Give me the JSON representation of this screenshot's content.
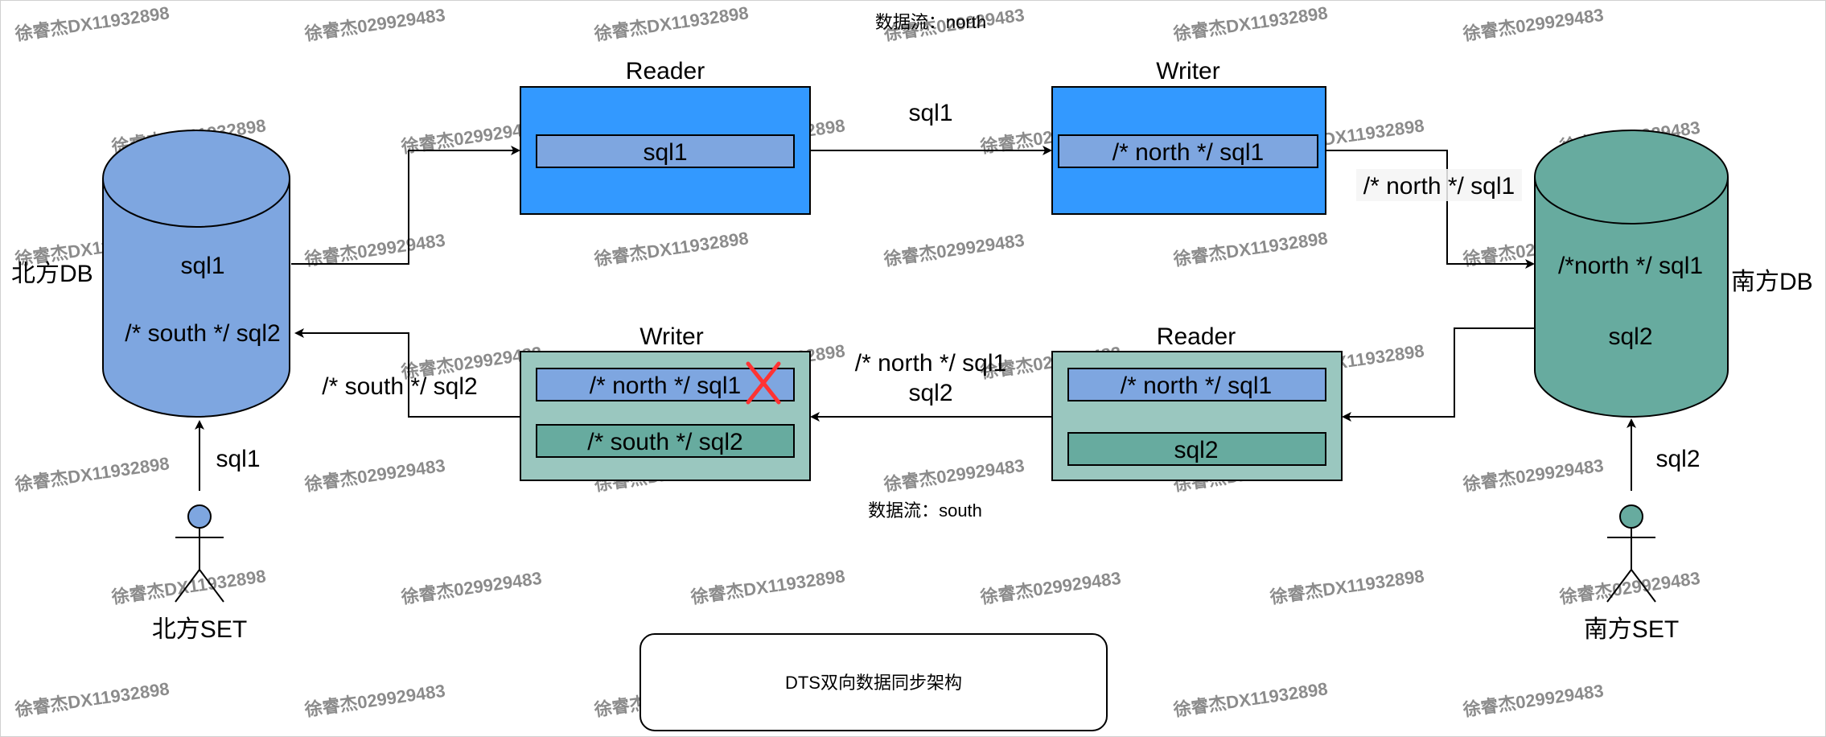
{
  "colors": {
    "north_db": "#7ea6e0",
    "south_db": "#67ab9f",
    "north_box": "#3399ff",
    "north_inner": "#7ea6e0",
    "south_box": "#9ac7bf",
    "south_inner": "#67ab9f",
    "cross": "#ff3333"
  },
  "labels": {
    "north_flow": "数据流：north",
    "south_flow": "数据流：south",
    "caption": "DTS双向数据同步架构"
  },
  "north_db": {
    "label": "北方DB",
    "row1": "sql1",
    "row2": "/* south */ sql2"
  },
  "south_db": {
    "label": "南方DB",
    "row1": "/*north */ sql1",
    "row2": "sql2"
  },
  "north_reader": {
    "title": "Reader",
    "item": "sql1"
  },
  "north_writer": {
    "title": "Writer",
    "item": "/* north */ sql1"
  },
  "south_reader": {
    "title": "Reader",
    "item1": "/* north */ sql1",
    "item2": "sql2"
  },
  "south_writer": {
    "title": "Writer",
    "item1": "/* north */ sql1",
    "item2": "/* south */ sql2"
  },
  "edges": {
    "reader_to_writer_north": "sql1",
    "writer_to_south_db": "/* north */ sql1",
    "reader_to_writer_south_line1": "/* north */ sql1",
    "reader_to_writer_south_line2": "sql2",
    "writer_to_north_db": "/* south */ sql2",
    "north_user_to_db": "sql1",
    "south_user_to_db": "sql2"
  },
  "north_user": {
    "label": "北方SET"
  },
  "south_user": {
    "label": "南方SET"
  },
  "watermarks": [
    "徐睿杰DX11932898",
    "徐睿杰029929483"
  ]
}
